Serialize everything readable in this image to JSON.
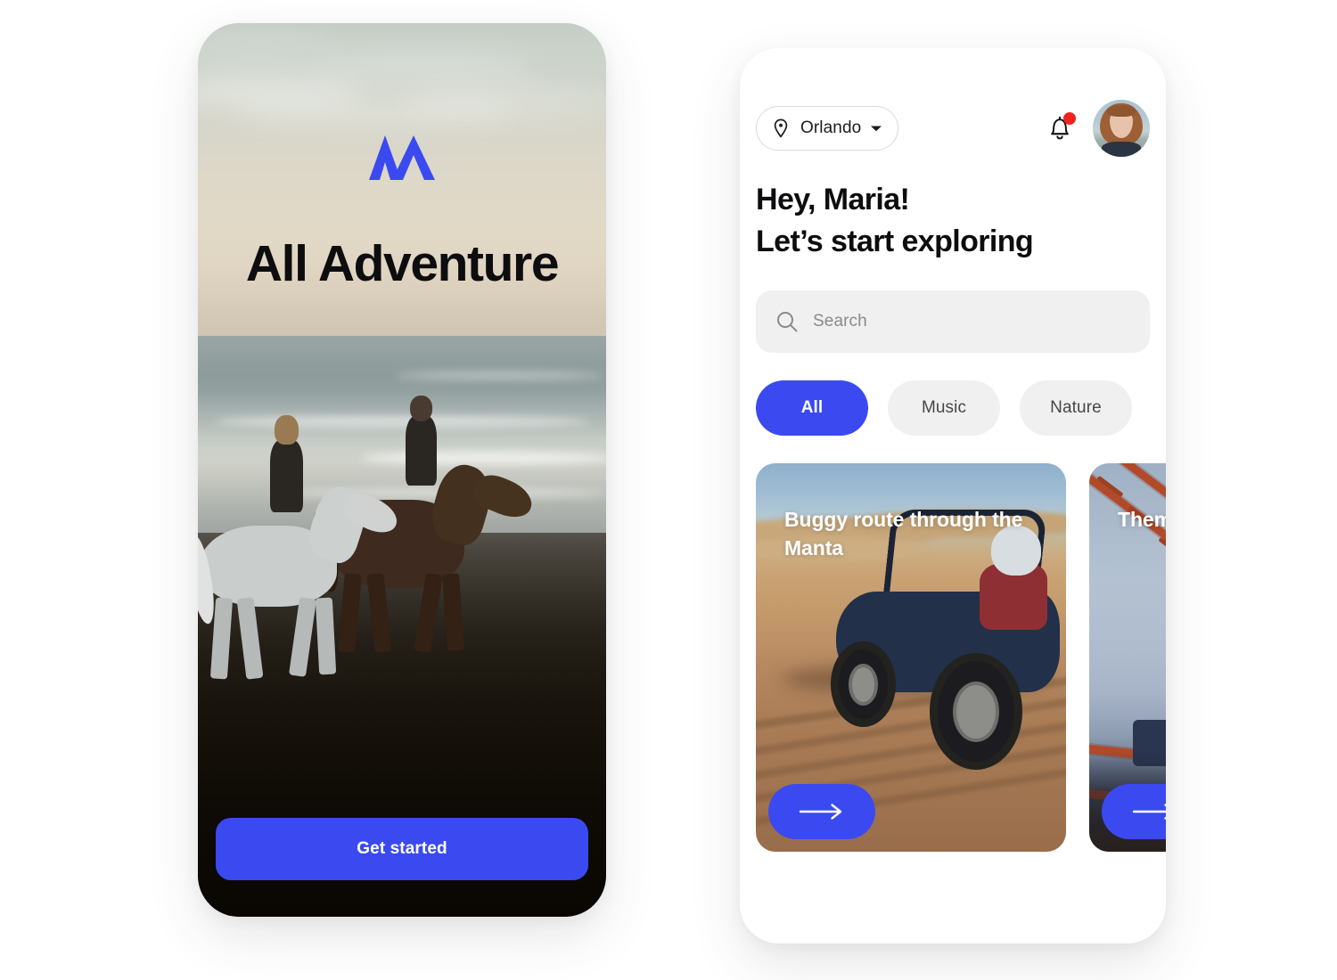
{
  "brand": {
    "accent_color": "#3b4af0",
    "logo_name": "mountain-m-logo"
  },
  "onboarding": {
    "title": "All Adventure",
    "cta_label": "Get started",
    "background_description": "two riders on horseback on a beach at dusk"
  },
  "home": {
    "location": {
      "label": "Orlando",
      "pin_icon": "location-pin-icon",
      "chevron_icon": "chevron-down-icon"
    },
    "notifications": {
      "icon": "bell-icon",
      "has_unread": true,
      "dot_color": "#f02323"
    },
    "avatar": {
      "icon": "avatar",
      "alt": "Maria profile photo"
    },
    "greeting": {
      "line1": "Hey, Maria!",
      "line2": "Let’s start exploring"
    },
    "search": {
      "placeholder": "Search",
      "value": "",
      "icon": "search-icon"
    },
    "filters": [
      {
        "label": "All",
        "active": true
      },
      {
        "label": "Music",
        "active": false
      },
      {
        "label": "Nature",
        "active": false
      },
      {
        "label": "",
        "active": false
      }
    ],
    "cards": [
      {
        "title": "Buggy route through the Manta",
        "image_description": "dune buggy driving across desert sand tracks",
        "action_icon": "arrow-right-icon"
      },
      {
        "title": "Theme park",
        "title_visible": "Them… park",
        "image_description": "roller coaster at a theme park",
        "action_icon": "arrow-right-icon"
      }
    ]
  }
}
